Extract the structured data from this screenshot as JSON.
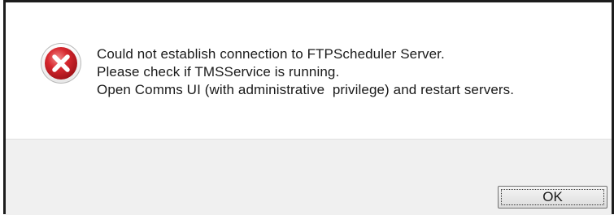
{
  "dialog": {
    "icon": "error-icon",
    "icon_color": "#d7282f",
    "message_lines": [
      "Could not establish connection to FTPScheduler Server.",
      "Please check if TMSService is running.",
      "Open Comms UI (with administrative  privilege) and restart servers."
    ],
    "ok_label": "OK"
  }
}
